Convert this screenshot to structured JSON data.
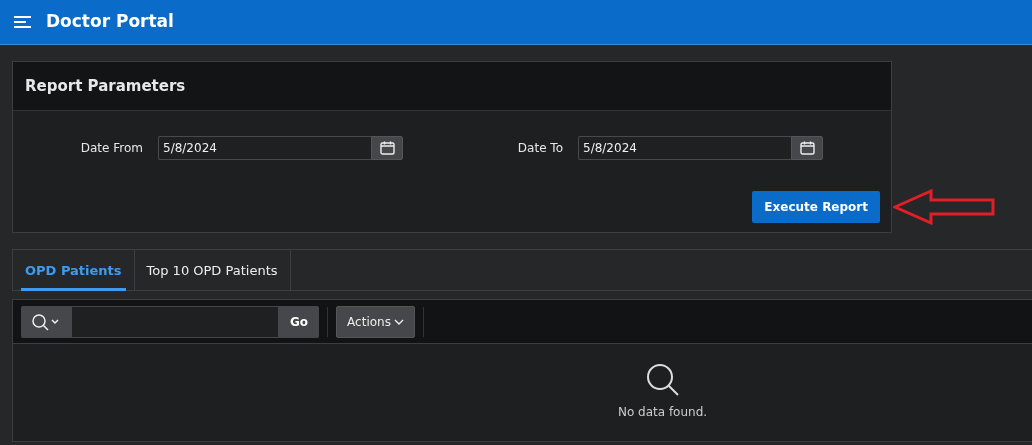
{
  "app": {
    "title": "Doctor Portal"
  },
  "report_parameters": {
    "title": "Report Parameters",
    "fields": [
      {
        "label": "Date From",
        "value": "5/8/2024"
      },
      {
        "label": "Date To",
        "value": "5/8/2024"
      }
    ],
    "button": "Execute Report"
  },
  "tabs": [
    {
      "label": "OPD Patients",
      "selected": true
    },
    {
      "label": "Top 10 OPD Patients",
      "selected": false
    }
  ],
  "toolbar": {
    "go_button": "Go",
    "actions_button": "Actions"
  },
  "empty_message": "No data found."
}
